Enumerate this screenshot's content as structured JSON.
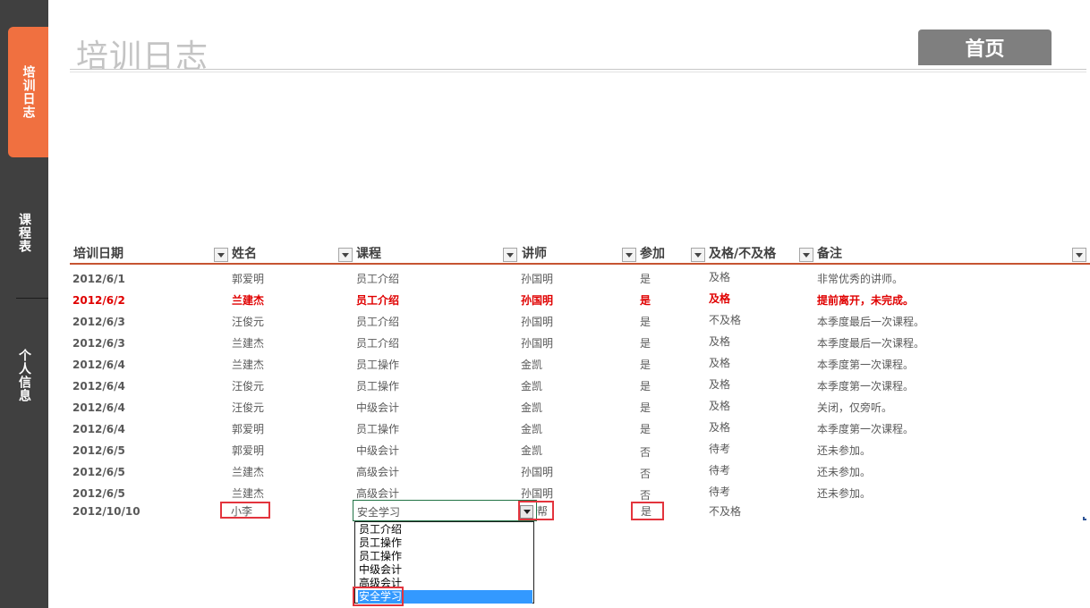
{
  "sidebar": {
    "tabs": [
      {
        "label": "培训日志",
        "active": true
      },
      {
        "label": "课程表",
        "active": false
      },
      {
        "label": "个人信息",
        "active": false
      }
    ]
  },
  "header": {
    "title": "培训日志",
    "home_button": "首页"
  },
  "table": {
    "columns": [
      "培训日期",
      "姓名",
      "课程",
      "讲师",
      "参加",
      "及格/不及格",
      "备注"
    ],
    "rows": [
      [
        "2012/6/1",
        "郭爱明",
        "员工介绍",
        "孙国明",
        "是",
        "及格",
        "非常优秀的讲师。"
      ],
      [
        "2012/6/2",
        "兰建杰",
        "员工介绍",
        "孙国明",
        "是",
        "及格",
        "提前离开，未完成。"
      ],
      [
        "2012/6/3",
        "汪俊元",
        "员工介绍",
        "孙国明",
        "是",
        "不及格",
        "本季度最后一次课程。"
      ],
      [
        "2012/6/3",
        "兰建杰",
        "员工介绍",
        "孙国明",
        "是",
        "及格",
        "本季度最后一次课程。"
      ],
      [
        "2012/6/4",
        "兰建杰",
        "员工操作",
        "金凯",
        "是",
        "及格",
        "本季度第一次课程。"
      ],
      [
        "2012/6/4",
        "汪俊元",
        "员工操作",
        "金凯",
        "是",
        "及格",
        "本季度第一次课程。"
      ],
      [
        "2012/6/4",
        "汪俊元",
        "中级会计",
        "金凯",
        "是",
        "及格",
        "关闭，仅旁听。"
      ],
      [
        "2012/6/4",
        "郭爱明",
        "员工操作",
        "金凯",
        "是",
        "及格",
        "本季度第一次课程。"
      ],
      [
        "2012/6/5",
        "郭爱明",
        "中级会计",
        "金凯",
        "否",
        "待考",
        "还未参加。"
      ],
      [
        "2012/6/5",
        "兰建杰",
        "高级会计",
        "孙国明",
        "否",
        "待考",
        "还未参加。"
      ],
      [
        "2012/6/5",
        "兰建杰",
        "高级会计",
        "孙国明",
        "否",
        "待考",
        "还未参加。"
      ]
    ],
    "highlight_row": 1,
    "entry_row": {
      "date": "2012/10/10",
      "name": "小李",
      "course": "安全学习",
      "instructor_partial": "帮",
      "attend": "是",
      "pass": "不及格"
    }
  },
  "dropdown": {
    "options": [
      "员工介绍",
      "员工操作",
      "员工操作",
      "中级会计",
      "高级会计",
      "安全学习"
    ],
    "selected_index": 5
  },
  "colors": {
    "sidebar_bg": "#404040",
    "active_tab": "#f07040",
    "header_rule": "#c65432",
    "highlight_text": "#e00000",
    "annotation_box": "#e3343d",
    "selection": "#3399ff"
  }
}
